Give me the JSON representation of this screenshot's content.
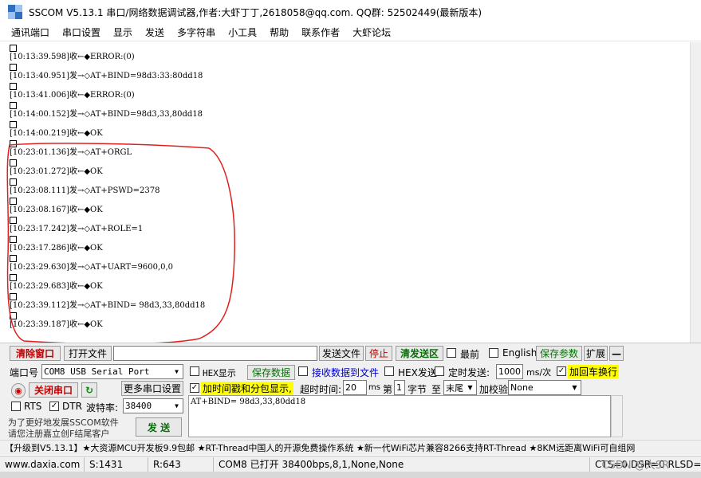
{
  "window": {
    "title": "SSCOM V5.13.1 串口/网络数据调试器,作者:大虾丁丁,2618058@qq.com. QQ群: 52502449(最新版本)"
  },
  "menu": [
    "通讯端口",
    "串口设置",
    "显示",
    "发送",
    "多字符串",
    "小工具",
    "帮助",
    "联系作者",
    "大虾论坛"
  ],
  "log": [
    {
      "text": "[10:13:39.598]收←◆ERROR:(0)"
    },
    {
      "text": "[10:13:40.951]发→◇AT+BIND=98d3:33:80dd18"
    },
    {
      "text": "[10:13:41.006]收←◆ERROR:(0)"
    },
    {
      "text": "[10:14:00.152]发→◇AT+BIND=98d3,33,80dd18"
    },
    {
      "text": "[10:14:00.219]收←◆OK"
    },
    {
      "text": "[10:23:01.136]发→◇AT+ORGL"
    },
    {
      "text": "[10:23:01.272]收←◆OK"
    },
    {
      "text": "[10:23:08.111]发→◇AT+PSWD=2378"
    },
    {
      "text": "[10:23:08.167]收←◆OK"
    },
    {
      "text": "[10:23:17.242]发→◇AT+ROLE=1"
    },
    {
      "text": "[10:23:17.286]收←◆OK"
    },
    {
      "text": "[10:23:29.630]发→◇AT+UART=9600,0,0"
    },
    {
      "text": "[10:23:29.683]收←◆OK"
    },
    {
      "text": "[10:23:39.112]发→◇AT+BIND= 98d3,33,80dd18"
    },
    {
      "text": "[10:23:39.187]收←◆OK"
    }
  ],
  "toolbar": {
    "clear_window": "清除窗口",
    "open_file": "打开文件",
    "file_path": "",
    "send_file": "发送文件",
    "stop": "停止",
    "clear_send": "清发送区",
    "latest": "最前",
    "english": "English",
    "save_params": "保存参数",
    "expand": "扩展",
    "collapse": "—"
  },
  "port": {
    "port_label": "端口号",
    "port_value": "COM8 USB Serial Port",
    "close_port": "关闭串口",
    "more_settings": "更多串口设置",
    "rts": "RTS",
    "dtr": "DTR",
    "baud_label": "波特率:",
    "baud_value": "38400",
    "promo_line1": "为了更好地发展SSCOM软件",
    "promo_line2": "请您注册嘉立创F结尾客户"
  },
  "options": {
    "hex_display": "HEX显示",
    "save_data": "保存数据",
    "recv_to_file": "接收数据到文件",
    "hex_send": "HEX发送",
    "timed_send": "定时发送:",
    "timed_value": "1000",
    "timed_unit": "ms/次",
    "add_crlf": "加回车换行",
    "add_timestamp": "加时间戳和分包显示,",
    "timeout_label": "超时时间:",
    "timeout_value": "20",
    "timeout_unit": "ms",
    "byte_nth": "第",
    "byte_value": "1",
    "byte_label": "字节",
    "to_label": "至",
    "to_value": "末尾",
    "checksum_label": "加校验",
    "checksum_value": "None"
  },
  "send": {
    "text": "AT+BIND= 98d3,33,80dd18",
    "send_button": "发 送"
  },
  "promo_bar": "【升级到V5.13.1】★大资源MCU开发板9.9包邮 ★RT-Thread中国人的开源免费操作系统 ★新一代WiFi芯片兼容8266支持RT-Thread ★8KM远距离WiFi可自组网",
  "status": {
    "website": "www.daxia.com",
    "sent": "S:1431",
    "received": "R:643",
    "port_state": "COM8 已打开  38400bps,8,1,None,None",
    "signals": "CTS=0 DSR=0 RLSD=0"
  },
  "watermark": "CSDN @大SR"
}
